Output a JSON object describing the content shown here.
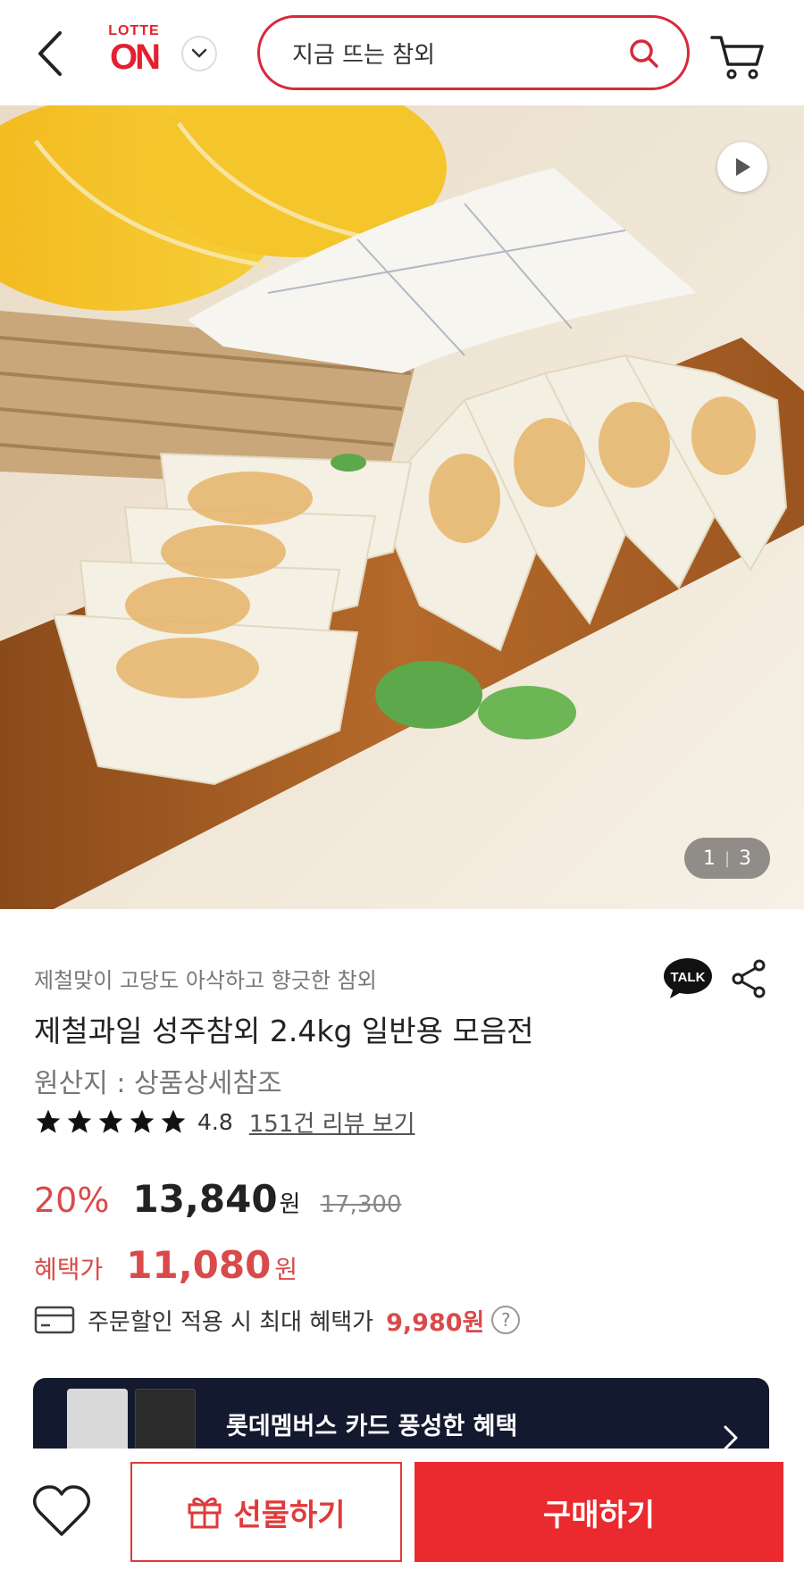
{
  "header": {
    "logo_top": "LOTTE",
    "logo_bottom": "ON",
    "search_text": "지금 뜨는 참외",
    "icons": [
      "back-icon",
      "chevron-down-icon",
      "search-icon",
      "cart-icon"
    ]
  },
  "hero": {
    "page_current": "1",
    "page_sep": "|",
    "page_total": "3",
    "icons": [
      "play-icon"
    ]
  },
  "product": {
    "tagline": "제철맞이 고당도 아삭하고 향긋한 참외",
    "title": "제철과일 성주참외 2.4kg 일반용 모음전",
    "origin": "원산지 : 상품상세참조",
    "rating": "4.8",
    "rating_value": 4.8,
    "review_link": "151건 리뷰 보기",
    "talk_label": "TALK"
  },
  "price": {
    "discount": "20%",
    "price": "13,840",
    "currency": "원",
    "original_price": "17,300",
    "benefit_label": "혜택가",
    "benefit_price": "11,080",
    "benefit_currency": "원",
    "max_benefit_text": "주문할인 적용 시 최대 혜택가",
    "max_benefit_price": "9,980원",
    "help": "?"
  },
  "banner": {
    "text": "롯데멤버스 카드 풍성한 혜택"
  },
  "bottom_bar": {
    "gift_label": "선물하기",
    "buy_label": "구매하기"
  },
  "colors": {
    "accent": "#e4202f",
    "price_red": "#d94a4a",
    "buy_button": "#ea2a2e",
    "banner_bg": "#131a2f"
  }
}
